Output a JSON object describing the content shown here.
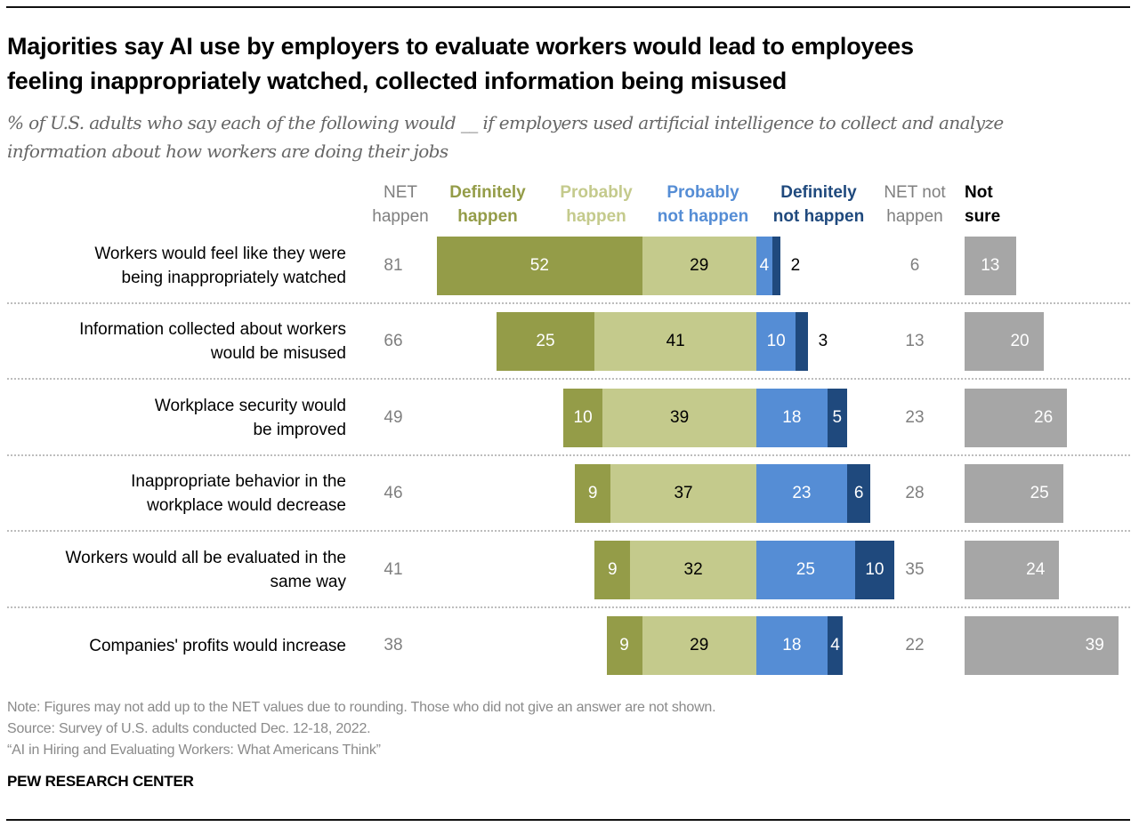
{
  "header": {
    "title_line1": "Majorities say AI use by employers to evaluate workers would lead to employees",
    "title_line2": "feeling inappropriately watched, collected information being misused",
    "subtitle_line1": "% of U.S. adults who say each of the following would __ if employers used artificial intelligence to collect and analyze",
    "subtitle_line2": "information about how workers are doing their jobs"
  },
  "colors": {
    "definitely_happen": "#949c48",
    "probably_happen": "#c4ca8c",
    "probably_not_happen": "#558dd5",
    "definitely_not_happen": "#1f497d",
    "not_sure": "#a6a6a6",
    "net_text": "#7f7f7f"
  },
  "chart_data": {
    "type": "bar",
    "subtype": "diverging-stacked-horizontal",
    "title": "Majorities say AI use by employers to evaluate workers would lead to employees feeling inappropriately watched, collected information being misused",
    "subtitle": "% of U.S. adults who say each of the following would __ if employers used artificial intelligence to collect and analyze information about how workers are doing their jobs",
    "column_headers": {
      "net_happen": [
        "NET",
        "happen"
      ],
      "definitely_happen": [
        "Definitely",
        "happen"
      ],
      "probably_happen": [
        "Probably",
        "happen"
      ],
      "probably_not_happen": [
        "Probably",
        "not happen"
      ],
      "definitely_not_happen": [
        "Definitely",
        "not happen"
      ],
      "net_not_happen": [
        "NET not",
        "happen"
      ],
      "not_sure": [
        "Not",
        "sure"
      ]
    },
    "categories": [
      [
        "Workers would feel like they were",
        "being inappropriately watched"
      ],
      [
        "Information collected about workers",
        "would be misused"
      ],
      [
        "Workplace security would",
        "be improved"
      ],
      [
        "Inappropriate behavior in the",
        "workplace would decrease"
      ],
      [
        "Workers would all be evaluated in the",
        "same way"
      ],
      [
        "Companies' profits would increase"
      ]
    ],
    "series": [
      {
        "name": "Definitely happen",
        "values": [
          52,
          25,
          10,
          9,
          9,
          9
        ]
      },
      {
        "name": "Probably happen",
        "values": [
          29,
          41,
          39,
          37,
          32,
          29
        ]
      },
      {
        "name": "Probably not happen",
        "values": [
          4,
          10,
          18,
          23,
          25,
          18
        ]
      },
      {
        "name": "Definitely not happen",
        "values": [
          2,
          3,
          5,
          6,
          10,
          4
        ]
      },
      {
        "name": "Not sure",
        "values": [
          13,
          20,
          26,
          25,
          24,
          39
        ]
      }
    ],
    "net_happen": [
      81,
      66,
      49,
      46,
      41,
      38
    ],
    "net_not_happen": [
      6,
      13,
      23,
      28,
      35,
      22
    ],
    "xlim": [
      0,
      100
    ],
    "grid": false,
    "legend": "top (column headers)"
  },
  "footer": {
    "note": "Note: Figures may not add up to the NET values due to rounding. Those who did not give an answer are not shown.",
    "source": "Source: Survey of U.S. adults conducted Dec. 12-18, 2022.",
    "report": "“AI in Hiring and Evaluating Workers: What Americans Think”",
    "brand": "PEW RESEARCH CENTER"
  }
}
